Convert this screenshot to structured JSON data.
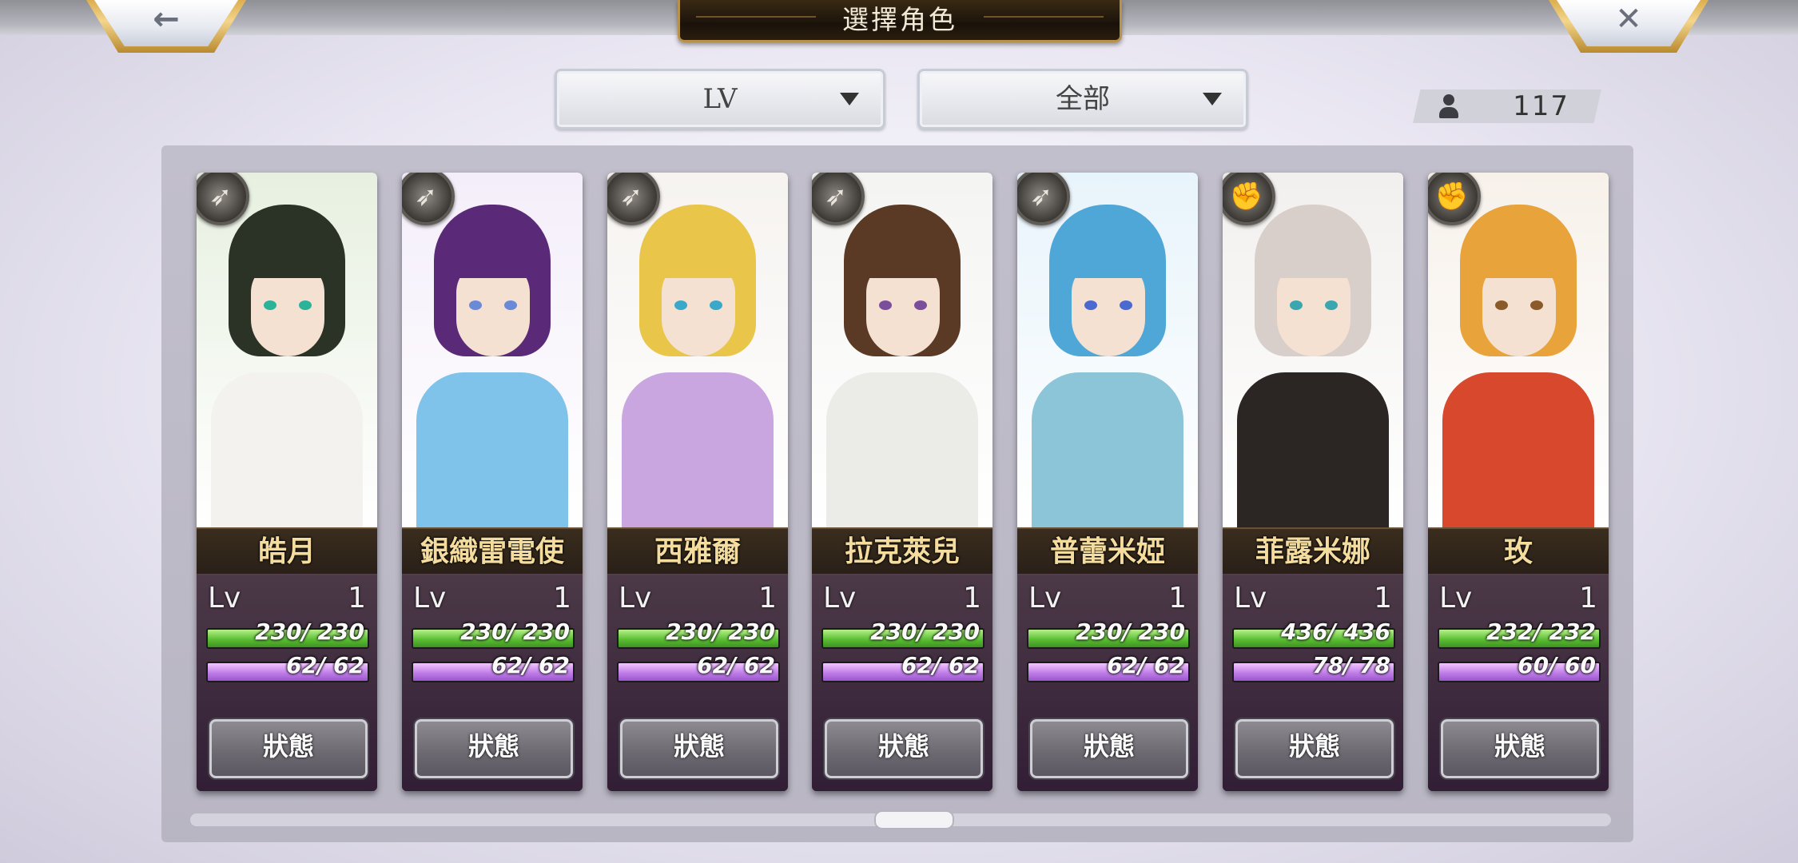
{
  "header": {
    "title": "選擇角色",
    "back_icon": "arrow-left-icon",
    "close_icon": "close-icon"
  },
  "filters": {
    "sort_value": "LV",
    "category_value": "全部"
  },
  "counter": {
    "icon": "person-icon",
    "value": "117"
  },
  "characters": [
    {
      "name": "皓月",
      "class_icon": "bow-icon",
      "lv_label": "Lv",
      "lv": "1",
      "hp": "230/ 230",
      "mp": "62/ 62",
      "status_label": "狀態",
      "bg": "#e7f0e0",
      "hair": "#2a3326",
      "outfit": "#f4f2ee",
      "eyes": "#2bb39a"
    },
    {
      "name": "銀織雷電使",
      "class_icon": "bow-icon",
      "lv_label": "Lv",
      "lv": "1",
      "hp": "230/ 230",
      "mp": "62/ 62",
      "status_label": "狀態",
      "bg": "#f4eefa",
      "hair": "#5a2a78",
      "outfit": "#7fc3ea",
      "eyes": "#6a8ad8"
    },
    {
      "name": "西雅爾",
      "class_icon": "bow-icon",
      "lv_label": "Lv",
      "lv": "1",
      "hp": "230/ 230",
      "mp": "62/ 62",
      "status_label": "狀態",
      "bg": "#f6f3f0",
      "hair": "#e9c64a",
      "outfit": "#c9a6df",
      "eyes": "#3aa8c8"
    },
    {
      "name": "拉克萊兒",
      "class_icon": "bow-icon",
      "lv_label": "Lv",
      "lv": "1",
      "hp": "230/ 230",
      "mp": "62/ 62",
      "status_label": "狀態",
      "bg": "#f4f4f2",
      "hair": "#5b3a25",
      "outfit": "#ebebe8",
      "eyes": "#7a4e9a"
    },
    {
      "name": "普蕾米婭",
      "class_icon": "bow-icon",
      "lv_label": "Lv",
      "lv": "1",
      "hp": "230/ 230",
      "mp": "62/ 62",
      "status_label": "狀態",
      "bg": "#e8f4fb",
      "hair": "#4fa7d8",
      "outfit": "#8cc4d8",
      "eyes": "#4a6ad0"
    },
    {
      "name": "菲露米娜",
      "class_icon": "gauntlet-icon",
      "lv_label": "Lv",
      "lv": "1",
      "hp": "436/ 436",
      "mp": "78/ 78",
      "status_label": "狀態",
      "bg": "#f2f0ee",
      "hair": "#d9cfca",
      "outfit": "#2b2623",
      "eyes": "#3aa6b0"
    },
    {
      "name": "玫",
      "class_icon": "gauntlet-icon",
      "lv_label": "Lv",
      "lv": "1",
      "hp": "232/ 232",
      "mp": "60/ 60",
      "status_label": "狀態",
      "bg": "#f7f1ea",
      "hair": "#e8a33a",
      "outfit": "#d8482c",
      "eyes": "#8a5a2a"
    }
  ]
}
